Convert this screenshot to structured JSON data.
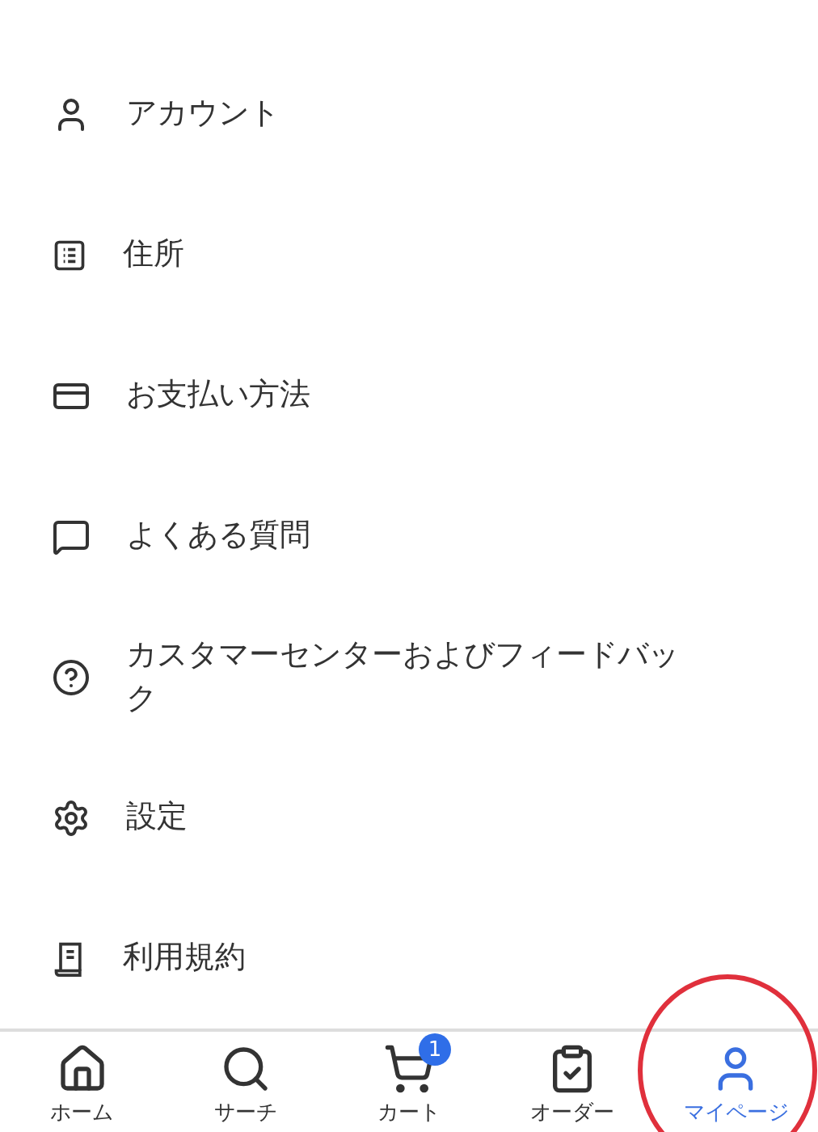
{
  "menu": [
    {
      "kind": "person",
      "label": "アカウント"
    },
    {
      "kind": "address",
      "label": "住所"
    },
    {
      "kind": "card",
      "label": "お支払い方法"
    },
    {
      "kind": "chat",
      "label": "よくある質問"
    },
    {
      "kind": "help",
      "label": "カスタマーセンターおよびフィードバック"
    },
    {
      "kind": "gear",
      "label": "設定"
    },
    {
      "kind": "terms",
      "label": "利用規約"
    }
  ],
  "nav": [
    {
      "kind": "home",
      "label": "ホーム",
      "selected": false
    },
    {
      "kind": "search",
      "label": "サーチ",
      "selected": false
    },
    {
      "kind": "cart",
      "label": "カート",
      "selected": false,
      "badge": "1"
    },
    {
      "kind": "orders",
      "label": "オーダー",
      "selected": false
    },
    {
      "kind": "person",
      "label": "マイページ",
      "selected": true
    }
  ]
}
